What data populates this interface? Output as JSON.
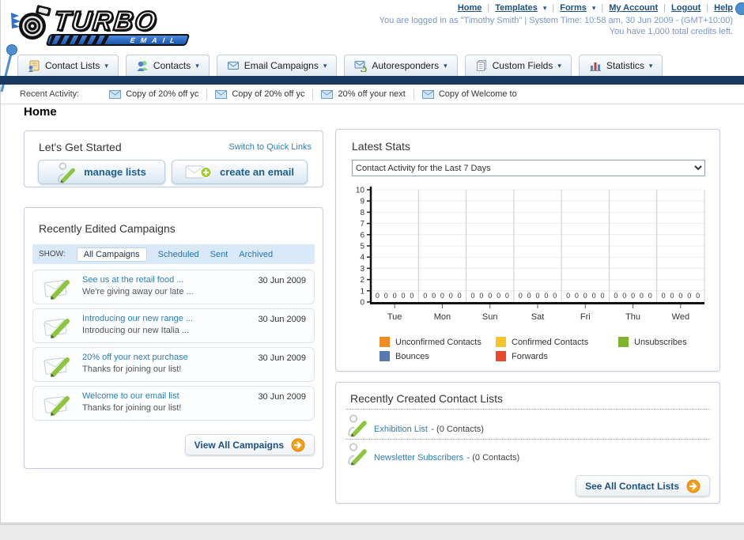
{
  "header": {
    "logo_line1": "TURBO",
    "logo_line2": "EMAIL",
    "nav": [
      {
        "label": "Home",
        "dropdown": false
      },
      {
        "label": "Templates",
        "dropdown": true
      },
      {
        "label": "Forms",
        "dropdown": true
      },
      {
        "label": "My Account",
        "dropdown": false
      },
      {
        "label": "Logout",
        "dropdown": false
      },
      {
        "label": "Help",
        "dropdown": false
      }
    ],
    "login_info": "You are logged in as \"Timothy Smith\" | System Time: 10:58 am, 30 Jun 2009 - (GMT+10:00)",
    "credits_info": "You have 1,000 total credits left."
  },
  "main_nav": {
    "tabs": [
      {
        "label": "Contact Lists",
        "icon": "contact-lists-icon"
      },
      {
        "label": "Contacts",
        "icon": "contacts-icon"
      },
      {
        "label": "Email Campaigns",
        "icon": "email-campaigns-icon"
      },
      {
        "label": "Autoresponders",
        "icon": "autoresponders-icon"
      },
      {
        "label": "Custom Fields",
        "icon": "custom-fields-icon"
      },
      {
        "label": "Statistics",
        "icon": "statistics-icon"
      }
    ]
  },
  "recent_activity": {
    "label": "Recent Activity:",
    "items": [
      "Copy of 20% off yc",
      "Copy of 20% off yc",
      "20% off your next",
      "Copy of Welcome to"
    ]
  },
  "page_title": "Home",
  "get_started": {
    "title": "Let's Get Started",
    "switch_link": "Switch to Quick Links",
    "manage_lists_label": "manage lists",
    "create_email_label": "create an email"
  },
  "campaigns": {
    "title": "Recently Edited Campaigns",
    "show_label": "SHOW:",
    "filters": [
      "All Campaigns",
      "Scheduled",
      "Sent",
      "Archived"
    ],
    "active_filter": "All Campaigns",
    "items": [
      {
        "title": "See us at the retail food ...",
        "subtitle": "We're giving away our late ...",
        "date": "30 Jun 2009"
      },
      {
        "title": "Introducing our new range ...",
        "subtitle": "Introducing our new Italia ...",
        "date": "30 Jun 2009"
      },
      {
        "title": "20% off your next purchase",
        "subtitle": "Thanks for joining our list!",
        "date": "30 Jun 2009"
      },
      {
        "title": "Welcome to our email list",
        "subtitle": "Thanks for joining our list!",
        "date": "30 Jun 2009"
      }
    ],
    "view_all_label": "View All Campaigns"
  },
  "stats": {
    "title": "Latest Stats",
    "dropdown_value": "Contact Activity for the Last 7 Days"
  },
  "chart_data": {
    "type": "bar",
    "title": "Contact Activity for the Last 7 Days",
    "categories": [
      "Tue",
      "Mon",
      "Sun",
      "Sat",
      "Fri",
      "Thu",
      "Wed"
    ],
    "series": [
      {
        "name": "Unconfirmed Contacts",
        "color": "#ef8d22",
        "values": [
          0,
          0,
          0,
          0,
          0,
          0,
          0
        ]
      },
      {
        "name": "Confirmed Contacts",
        "color": "#f7c52b",
        "values": [
          0,
          0,
          0,
          0,
          0,
          0,
          0
        ]
      },
      {
        "name": "Unsubscribes",
        "color": "#7db32d",
        "values": [
          0,
          0,
          0,
          0,
          0,
          0,
          0
        ]
      },
      {
        "name": "Bounces",
        "color": "#5a78b0",
        "values": [
          0,
          0,
          0,
          0,
          0,
          0,
          0
        ]
      },
      {
        "name": "Forwards",
        "color": "#e64a2a",
        "values": [
          0,
          0,
          0,
          0,
          0,
          0,
          0
        ]
      }
    ],
    "ylim": [
      0,
      10
    ],
    "ytick_step": 1,
    "grid": true,
    "legend_position": "bottom",
    "value_labels_shown": true
  },
  "contact_lists": {
    "title": "Recently Created Contact Lists",
    "items": [
      {
        "name": "Exhibition List",
        "detail": "- (0 Contacts)"
      },
      {
        "name": "Newsletter Subscribers",
        "detail": "- (0 Contacts)"
      }
    ],
    "see_all_label": "See All Contact Lists"
  },
  "icons": {
    "chevron_down": "▾",
    "separator": "|"
  },
  "colors": {
    "navy_bar": "#17395d",
    "link_blue": "#1b5185",
    "teal_link": "#2d7fb8",
    "show_bar_bg": "#d9e9f7",
    "arrow_orange": "#f59e18"
  }
}
